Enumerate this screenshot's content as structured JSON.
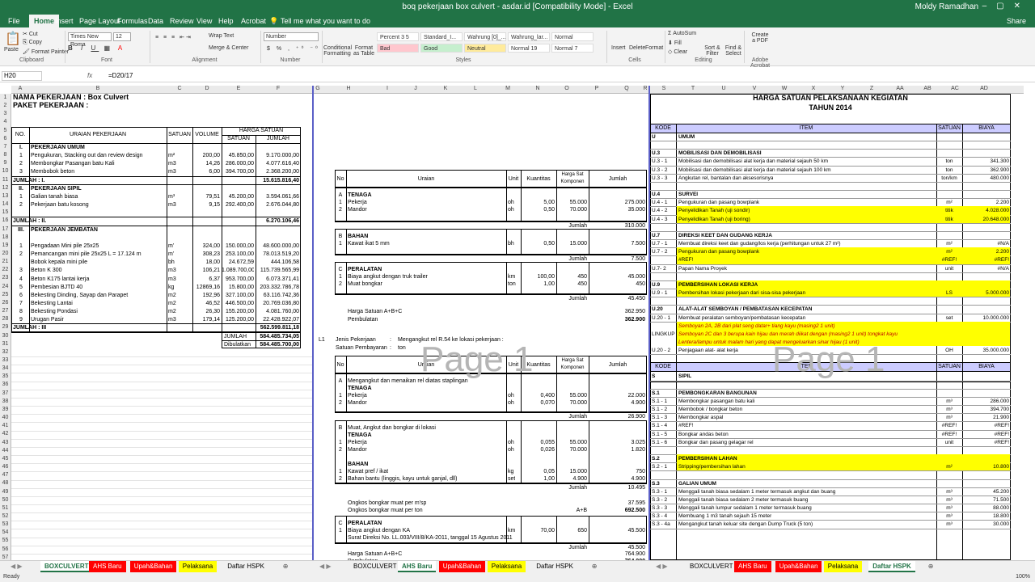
{
  "window": {
    "title": "boq pekerjaan box culvert - asdar.id  [Compatibility Mode]  -  Excel",
    "user": "Moldy Ramadhan",
    "share": "Share"
  },
  "tabs": [
    "File",
    "Home",
    "Insert",
    "Page Layout",
    "Formulas",
    "Data",
    "Review",
    "View",
    "Help",
    "Acrobat"
  ],
  "tell_me": "Tell me what you want to do",
  "ribbon": {
    "clipboard": "Clipboard",
    "paste": "Paste",
    "cut": "Cut",
    "copy": "Copy",
    "format_painter": "Format Painter",
    "font": "Font",
    "font_name": "Times New Roma",
    "font_size": "12",
    "alignment": "Alignment",
    "wrap": "Wrap Text",
    "merge": "Merge & Center",
    "number": "Number",
    "number_fmt": "Number",
    "cond_fmt": "Conditional Formatting",
    "format_table": "Format as Table",
    "styles": "Styles",
    "cells": "Cells",
    "insert": "Insert",
    "delete": "Delete",
    "format": "Format",
    "editing": "Editing",
    "autosum": "AutoSum",
    "fill": "Fill",
    "clear": "Clear",
    "sort": "Sort & Filter",
    "find": "Find & Select",
    "acrobat": "Adobe Acrobat",
    "create_pdf": "Create a PDF",
    "style_items": [
      {
        "l": "Percent 3 5",
        "bg": "#ffffff"
      },
      {
        "l": "Standard_I...",
        "bg": "#ffffff"
      },
      {
        "l": "Wahrung [0]_...",
        "bg": "#ffffff"
      },
      {
        "l": "Wahrung_lar...",
        "bg": "#ffffff"
      },
      {
        "l": "Normal",
        "bg": "#ffffff"
      },
      {
        "l": "Bad",
        "bg": "#ffc7ce"
      },
      {
        "l": "Good",
        "bg": "#c6efce"
      },
      {
        "l": "Neutral",
        "bg": "#ffeb9c"
      },
      {
        "l": "Normal 19",
        "bg": "#ffffff"
      },
      {
        "l": "Normal 7",
        "bg": "#ffffff"
      }
    ]
  },
  "formula": {
    "namebox": "H20",
    "fx": "fx",
    "value": "=D20/17"
  },
  "pane1": {
    "cols": [
      "A",
      "B",
      "C",
      "D",
      "E",
      "F"
    ],
    "nama": "NAMA PEKERJAAN      :  Box Culvert",
    "paket": "PAKET PEKERJAAN       :",
    "h_no": "NO.",
    "h_uraian": "URAIAN  PEKERJAAN",
    "h_sat": "SATUAN",
    "h_vol": "VOLUME",
    "h_harga": "HARGA SATUAN",
    "h_satuan": "SATUAN",
    "h_jumlah": "JUMLAH",
    "rows": [
      {
        "r": 7,
        "a": "I.",
        "b": "PEKERJAAN UMUM",
        "bold": true
      },
      {
        "r": 8,
        "a": "1",
        "b": "Pengukuran, Stacking out dan review design",
        "c": "m²",
        "d": "200,00",
        "e": "45.850,00",
        "f": "9.170.000,00"
      },
      {
        "r": 9,
        "a": "2",
        "b": "Membongkar Pasangan batu Kali",
        "c": "m3",
        "d": "14,26",
        "e": "286.000,00",
        "f": "4.077.616,40"
      },
      {
        "r": 10,
        "a": "3",
        "b": "Membobok beton",
        "c": "m3",
        "d": "6,00",
        "e": "394.700,00",
        "f": "2.368.200,00"
      },
      {
        "r": 11,
        "a": "JUMLAH  :  I.",
        "f": "15.615.816,40",
        "bold": true
      },
      {
        "r": 12,
        "a": "II.",
        "b": "PEKERJAAN SIPIL",
        "bold": true
      },
      {
        "r": 13,
        "a": "1",
        "b": "Galian tanah biasa",
        "c": "m³",
        "d": "79,51",
        "e": "45.200,00",
        "f": "3.594.061,66"
      },
      {
        "r": 14,
        "a": "2",
        "b": "Pekerjaan batu kosong",
        "c": "m3",
        "d": "9,15",
        "e": "292.400,00",
        "f": "2.676.044,80"
      },
      {
        "r": 16,
        "a": "JUMLAH  :  II.",
        "f": "6.270.106,46",
        "bold": true
      },
      {
        "r": 17,
        "a": "III.",
        "b": "PEKERJAAN JEMBATAN",
        "bold": true
      },
      {
        "r": 19,
        "a": "1",
        "b": "Pengadaan Mini pile 25x25",
        "c": "m'",
        "d": "324,00",
        "e": "150.000,00",
        "f": "48.600.000,00"
      },
      {
        "r": 20,
        "a": "2",
        "b": "Pemancangan mini pile 25x25  L = 17.124 m",
        "c": "m'",
        "d": "308,23",
        "e": "253.100,00",
        "f": "78.013.519,20"
      },
      {
        "r": 21,
        "b": "Bobok kepala mini pile",
        "c": "bh",
        "d": "18,00",
        "e": "24.672,59",
        "f": "444.106,58"
      },
      {
        "r": 22,
        "a": "3",
        "b": "Beton K 300",
        "c": "m3",
        "d": "106,21",
        "e": "1.089.700,00",
        "f": "115.739.565,99"
      },
      {
        "r": 23,
        "a": "4",
        "b": "Beton K175 lantai kerja",
        "c": "m3",
        "d": "6,37",
        "e": "953.700,00",
        "f": "6.073.371,41"
      },
      {
        "r": 24,
        "a": "5",
        "b": "Pembesian BJTD 40",
        "c": "kg",
        "d": "12869,16",
        "e": "15.800,00",
        "f": "203.332.786,78"
      },
      {
        "r": 25,
        "a": "6",
        "b": "Bekesting Dinding, Sayap dan Parapet",
        "c": "m2",
        "d": "192,96",
        "e": "327.100,00",
        "f": "63.116.742,36"
      },
      {
        "r": 26,
        "a": "7",
        "b": "Bekesting Lantai",
        "c": "m2",
        "d": "46,52",
        "e": "446.500,00",
        "f": "20.769.036,80"
      },
      {
        "r": 27,
        "a": "8",
        "b": "Bekesting Pondasi",
        "c": "m2",
        "d": "26,30",
        "e": "155.200,00",
        "f": "4.081.760,00"
      },
      {
        "r": 28,
        "a": "9",
        "b": "Urugan Pasir",
        "c": "m3",
        "d": "179,14",
        "e": "125.200,00",
        "f": "22.428.922,07"
      },
      {
        "r": 29,
        "a": "JUMLAH  :  III",
        "f": "562.599.811,18",
        "bold": true
      }
    ],
    "jumlah_lbl": "JUMLAH",
    "jumlah_val": "584.485.734,05",
    "dibulatkan_lbl": "Dibulatkan",
    "dibulatkan_val": "584.485.700,00"
  },
  "pane2": {
    "cols": [
      "G",
      "H",
      "I",
      "J",
      "K",
      "L",
      "M",
      "N",
      "O",
      "P",
      "Q",
      "R"
    ],
    "title": "ANALISA HARGA SATUAN PEKERJAAN",
    "umum_no": "I.",
    "umum": "UMUM",
    "item_lbl": "Item Pembayaran",
    "item_val": "U.3-2",
    "jenis_lbl": "Jenis Pekerjaan",
    "jenis_val": "Angkutan  material sejauh 100 km",
    "satuan_lbl": "Satuan Pembayaran",
    "satuan_val": "Ton",
    "th_no": "No",
    "th_uraian": "Uraian",
    "th_unit": "Unit",
    "th_kuant": "Kuantitas",
    "th_harga": "Harga Sat Komponen",
    "th_jumlah": "Jumlah",
    "blockA": [
      {
        "t": "A",
        "b": "TENAGA"
      },
      {
        "t": "1",
        "b": "Pekerja",
        "u": "oh",
        "k": "5,00",
        "h": "55.000",
        "j": "275.000"
      },
      {
        "t": "2",
        "b": "Mandor",
        "u": "oh",
        "k": "0,50",
        "h": "70.000",
        "j": "35.000"
      }
    ],
    "jumlahA": "310.000",
    "blockB": [
      {
        "t": "B",
        "b": "BAHAN"
      },
      {
        "t": "1",
        "b": "Kawat ikat 5 mm",
        "u": "bh",
        "k": "0,50",
        "h": "15.000",
        "j": "7.500"
      }
    ],
    "jumlahB": "7.500",
    "blockC": [
      {
        "t": "C",
        "b": "PERALATAN"
      },
      {
        "t": "1",
        "b": "Biaya angkut dengan truk trailer",
        "u": "km",
        "k": "100,00",
        "h": "450",
        "j": "45.000"
      },
      {
        "t": "2",
        "b": "Muat bongkar",
        "u": "ton",
        "k": "1,00",
        "h": "450",
        "j": "450"
      }
    ],
    "jumlahC": "45.450",
    "harga_abc": "Harga Satuan A+B+C",
    "harga_abc_val": "362.950",
    "pembulatan": "Pembulatan",
    "pembulatan_val": "362.900",
    "l1": "L1",
    "jenis2_val": "Mengangkut rel R.54 ke lokasi pekerjaan :",
    "satuan2_val": "ton",
    "blockA2": [
      {
        "t": "A",
        "b": "Mengangkut dan menaikan rel diatas staplingan"
      },
      {
        "t": "",
        "b": "TENAGA"
      },
      {
        "t": "1",
        "b": "Pekerja",
        "u": "oh",
        "k": "0,400",
        "h": "55.000",
        "j": "22.000"
      },
      {
        "t": "2",
        "b": "Mandor",
        "u": "oh",
        "k": "0,070",
        "h": "70.000",
        "j": "4.900"
      }
    ],
    "jumlahA2": "26.900",
    "blockB2": [
      {
        "t": "B",
        "b": "Muat, Angkut dan bongkar di lokasi"
      },
      {
        "t": "",
        "b": "TENAGA"
      },
      {
        "t": "1",
        "b": "Pekerja",
        "u": "oh",
        "k": "0,055",
        "h": "55.000",
        "j": "3.025"
      },
      {
        "t": "2",
        "b": "Mandor",
        "u": "oh",
        "k": "0,026",
        "h": "70.000",
        "j": "1.820"
      }
    ],
    "bahan2": "BAHAN",
    "blockB3": [
      {
        "t": "1",
        "b": "Kawat pref / ikat",
        "u": "kg",
        "k": "0,05",
        "h": "15.000",
        "j": "750"
      },
      {
        "t": "2",
        "b": "Bahan bantu (linggis, kayu untuk ganjal, dll)",
        "u": "set",
        "k": "1,00",
        "h": "4.900",
        "j": "4.900"
      }
    ],
    "jumlahB2": "10.495",
    "ongkos1": "Ongkos bongkar muat per m'sp",
    "ongkos1_val": "37.595",
    "ongkos2": "Ongkos bongkar muat per ton",
    "ongkos2_ab": "A+B",
    "ongkos2_val": "692.500",
    "blockC2": [
      {
        "t": "C",
        "b": "PERALATAN"
      },
      {
        "t": "1",
        "b": "Biaya angkut dengan KA",
        "u": "km",
        "k": "70,00",
        "h": "650",
        "j": "45.500"
      },
      {
        "t": "",
        "b": "Surat Direksi No. LL.003/VIII/8/KA-2011, tanggal 15 Agustus 2011"
      }
    ],
    "jumlahC2": "45.500",
    "harga2_val": "764.900",
    "pembulatan2_val": "764.000",
    "jumlah": "Jumlah"
  },
  "pane3": {
    "cols": [
      "S",
      "T",
      "U",
      "V",
      "W",
      "X",
      "Y",
      "Z",
      "AA",
      "AB",
      "AC",
      "AD"
    ],
    "title": "HARGA SATUAN PELAKSANAAN KEGIATAN",
    "tahun": "TAHUN 2014",
    "th_kode": "KODE",
    "th_item": "ITEM",
    "th_sat": "SATUAN",
    "th_biaya": "BIAYA",
    "rows1": [
      {
        "k": "U",
        "i": "UMUM",
        "bold": true
      },
      {},
      {
        "k": "U.3",
        "i": "MOBILISASI DAN DEMOBILISASI",
        "bold": true
      },
      {
        "k": "U.3 - 1",
        "i": "Mobilisasi dan demobilisasi alat kerja dan material sejauh 50 km",
        "s": "ton",
        "b": "341.300"
      },
      {
        "k": "U.3 - 2",
        "i": "Mobilisasi dan demobilisasi alat kerja dan material sejauh 100 km",
        "s": "ton",
        "b": "362.900"
      },
      {
        "k": "U.3 - 3",
        "i": "Angkutan rel, bantalan dan aksesorisnya",
        "s": "ton/km",
        "b": "480.000"
      },
      {},
      {
        "k": "U.4",
        "i": "SURVEI",
        "bold": true
      },
      {
        "k": "U.4 - 1",
        "i": "Pengukuran dan pasang bowplank",
        "s": "m²",
        "b": "2.200"
      },
      {
        "k": "U.4 - 2",
        "i": "Penyelidikan Tanah (uji sondir)",
        "s": "titik",
        "b": "4.028.000",
        "y": true
      },
      {
        "k": "U.4 - 3",
        "i": "Penyelidikan Tanah (uji boring)",
        "s": "titik",
        "b": "20.648.000",
        "y": true
      },
      {},
      {
        "k": "U.7",
        "i": "DIREKSI KEET DAN GUDANG KERJA",
        "bold": true
      },
      {
        "k": "U.7 - 1",
        "i": "Membuat direksi keet dan gudang/los kerja (perhitungan untuk 27 m²)",
        "s": "m²",
        "b": "#N/A"
      },
      {
        "k": "U.7 - 2",
        "i": "Pengukuran dan pasang bowplank",
        "s": "m²",
        "b": "2.200",
        "y": true
      },
      {
        "k": "",
        "i": "#REF!",
        "s": "#REF!",
        "b": "#REF!",
        "y": true
      },
      {
        "k": "U.7- 2",
        "i": "Papan Nama Proyek",
        "s": "unit",
        "b": "#N/A"
      },
      {},
      {
        "k": "U.9",
        "i": "PEMBERSIHAN LOKASI KERJA",
        "bold": true,
        "y": true
      },
      {
        "k": "U.9 - 1",
        "i": "Pembersihan lokasi pekerjaan dari sisa-sisa pekerjaan",
        "s": "LS",
        "b": "5.000.000",
        "y": true
      },
      {},
      {
        "k": "U.20",
        "i": "ALAT-ALAT SEMBOYAN / PEMBATASAN KECEPATAN",
        "bold": true
      },
      {
        "k": "U.20 - 1",
        "i": "Membuat peralatan semboyan/pembatasan kecepatan",
        "s": "set",
        "b": "10.000.000"
      }
    ],
    "lingkup": "LINGKUP",
    "lingkup_lines": [
      "Semboyan 2A, 2B dari plat seng datar+ tiang kayu (masing2 1 unit)",
      "Semboyan 2C dan 3 berupa kain hijau dan merah diikat dengan (masing2 1 unit) tongkat kayu",
      "Lentera/lampu untuk malam hari yang dapat mengeluarkan sinar hijau (1 unit)"
    ],
    "u20_2": {
      "k": "U.20 - 2",
      "i": "Penjagaan alat- alat kerja",
      "s": "OH",
      "b": "35.000.000"
    },
    "rows2": [
      {
        "k": "S",
        "i": "SIPIL",
        "bold": true
      },
      {},
      {
        "k": "S.1",
        "i": "PEMBONGKARAN BANGUNAN",
        "bold": true
      },
      {
        "k": "S.1 - 1",
        "i": "Membongkar pasangan batu kali",
        "s": "m³",
        "b": "286.000"
      },
      {
        "k": "S.1 - 2",
        "i": "Membobok / bongkar beton",
        "s": "m³",
        "b": "394.700"
      },
      {
        "k": "S.1 - 3",
        "i": "Membongkar aspal",
        "s": "m³",
        "b": "21.900"
      },
      {
        "k": "S.1 - 4",
        "i": "#REF!",
        "s": "#REF!",
        "b": "#REF!"
      },
      {
        "k": "S.1 - 5",
        "i": "Bongkar andas beton",
        "s": "#REF!",
        "b": "#REF!"
      },
      {
        "k": "S.1 - 6",
        "i": "Bongkar dan pasang gelagar rel",
        "s": "unit",
        "b": "#REF!"
      },
      {},
      {
        "k": "S.2",
        "i": "PEMBERSIHAN LAHAN",
        "bold": true,
        "y": true
      },
      {
        "k": "S.2 - 1",
        "i": "Stripping/pembersihan lahan",
        "s": "m²",
        "b": "10.800",
        "y": true
      },
      {},
      {
        "k": "S.3",
        "i": "GALIAN UMUM",
        "bold": true
      },
      {
        "k": "S.3 - 1",
        "i": "Menggali tanah biasa sedalam 1 meter termasuk angkut dan buang",
        "s": "m³",
        "b": "45.200"
      },
      {
        "k": "S.3 - 2",
        "i": "Menggali tanah biasa sedalam 2 meter termasuk buang",
        "s": "m³",
        "b": "71.500"
      },
      {
        "k": "S.3 - 3",
        "i": "Menggali tanah lumpur sedalam 1 meter termasuk buang",
        "s": "m³",
        "b": "88.000"
      },
      {
        "k": "S.3 - 4",
        "i": "Membuang 1 m3 tanah sejauh 15 meter",
        "s": "m³",
        "b": "18.800"
      },
      {
        "k": "S.3 - 4a",
        "i": "Mengangkut tanah  keluar site dengan Dump Truck (5 ton)",
        "s": "m³",
        "b": "30.000"
      }
    ]
  },
  "watermark": "Page 1",
  "sheettabs1": [
    {
      "l": "BOXCULVERT",
      "c": "act"
    },
    {
      "l": "AHS Baru",
      "c": "red"
    },
    {
      "l": "Upah&Bahan",
      "c": "red"
    },
    {
      "l": "Pelaksana",
      "c": "yellow"
    },
    {
      "l": "Daftar HSPK",
      "c": ""
    }
  ],
  "sheettabs2": [
    {
      "l": "BOXCULVERT",
      "c": ""
    },
    {
      "l": "AHS Baru",
      "c": "act"
    },
    {
      "l": "Upah&Bahan",
      "c": "red"
    },
    {
      "l": "Pelaksana",
      "c": "yellow"
    },
    {
      "l": "Daftar HSPK",
      "c": ""
    }
  ],
  "sheettabs3": [
    {
      "l": "BOXCULVERT",
      "c": ""
    },
    {
      "l": "AHS Baru",
      "c": "red"
    },
    {
      "l": "Upah&Bahan",
      "c": "red"
    },
    {
      "l": "Pelaksana",
      "c": "yellow"
    },
    {
      "l": "Daftar HSPK",
      "c": "act"
    }
  ],
  "status": {
    "ready": "Ready",
    "zoom": "100%"
  }
}
